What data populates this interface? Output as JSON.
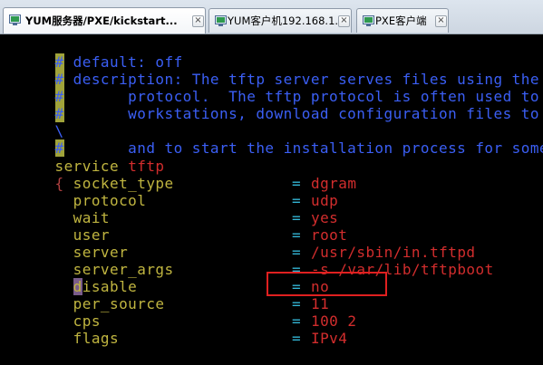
{
  "tabs": [
    {
      "label": "YUM服务器/PXE/kickstart...",
      "active": true,
      "close": "×"
    },
    {
      "label": "YUM客户机192.168.1.2",
      "active": false,
      "close": "×"
    },
    {
      "label": "PXE客户端",
      "active": false,
      "close": "×"
    }
  ],
  "terminal": {
    "comment_lines": [
      {
        "prefix": "#",
        "text": " default: off"
      },
      {
        "prefix": "#",
        "text": " description: The tftp server serves files using the trivia"
      },
      {
        "prefix": "#",
        "text": "       protocol.  The tftp protocol is often used to boot o"
      },
      {
        "prefix": "#",
        "text": "       workstations, download configuration files to networ"
      },
      {
        "prefix": "\\",
        "text": ""
      },
      {
        "prefix": "#",
        "text": "       and to start the installation process for some opera"
      }
    ],
    "service_keyword": "service",
    "service_name": "tftp",
    "open_brace": "{",
    "close_brace": "}",
    "settings": [
      {
        "key": "socket_type",
        "value": "dgram"
      },
      {
        "key": "protocol",
        "value": "udp"
      },
      {
        "key": "wait",
        "value": "yes"
      },
      {
        "key": "user",
        "value": "root"
      },
      {
        "key": "server",
        "value": "/usr/sbin/in.tftpd"
      },
      {
        "key": "server_args",
        "value": "-s /var/lib/tftpboot"
      },
      {
        "key_cursor": "d",
        "key": "isable",
        "value": "no"
      },
      {
        "key": "per_source",
        "value": "11"
      },
      {
        "key": "cps",
        "value": "100 2"
      },
      {
        "key": "flags",
        "value": "IPv4"
      }
    ],
    "equals": "="
  },
  "colors": {
    "comment": "#3b5ff5",
    "key": "#c0b540",
    "value": "#d22d2d",
    "equals": "#33b5d5",
    "highlight_box": "#e02020"
  }
}
